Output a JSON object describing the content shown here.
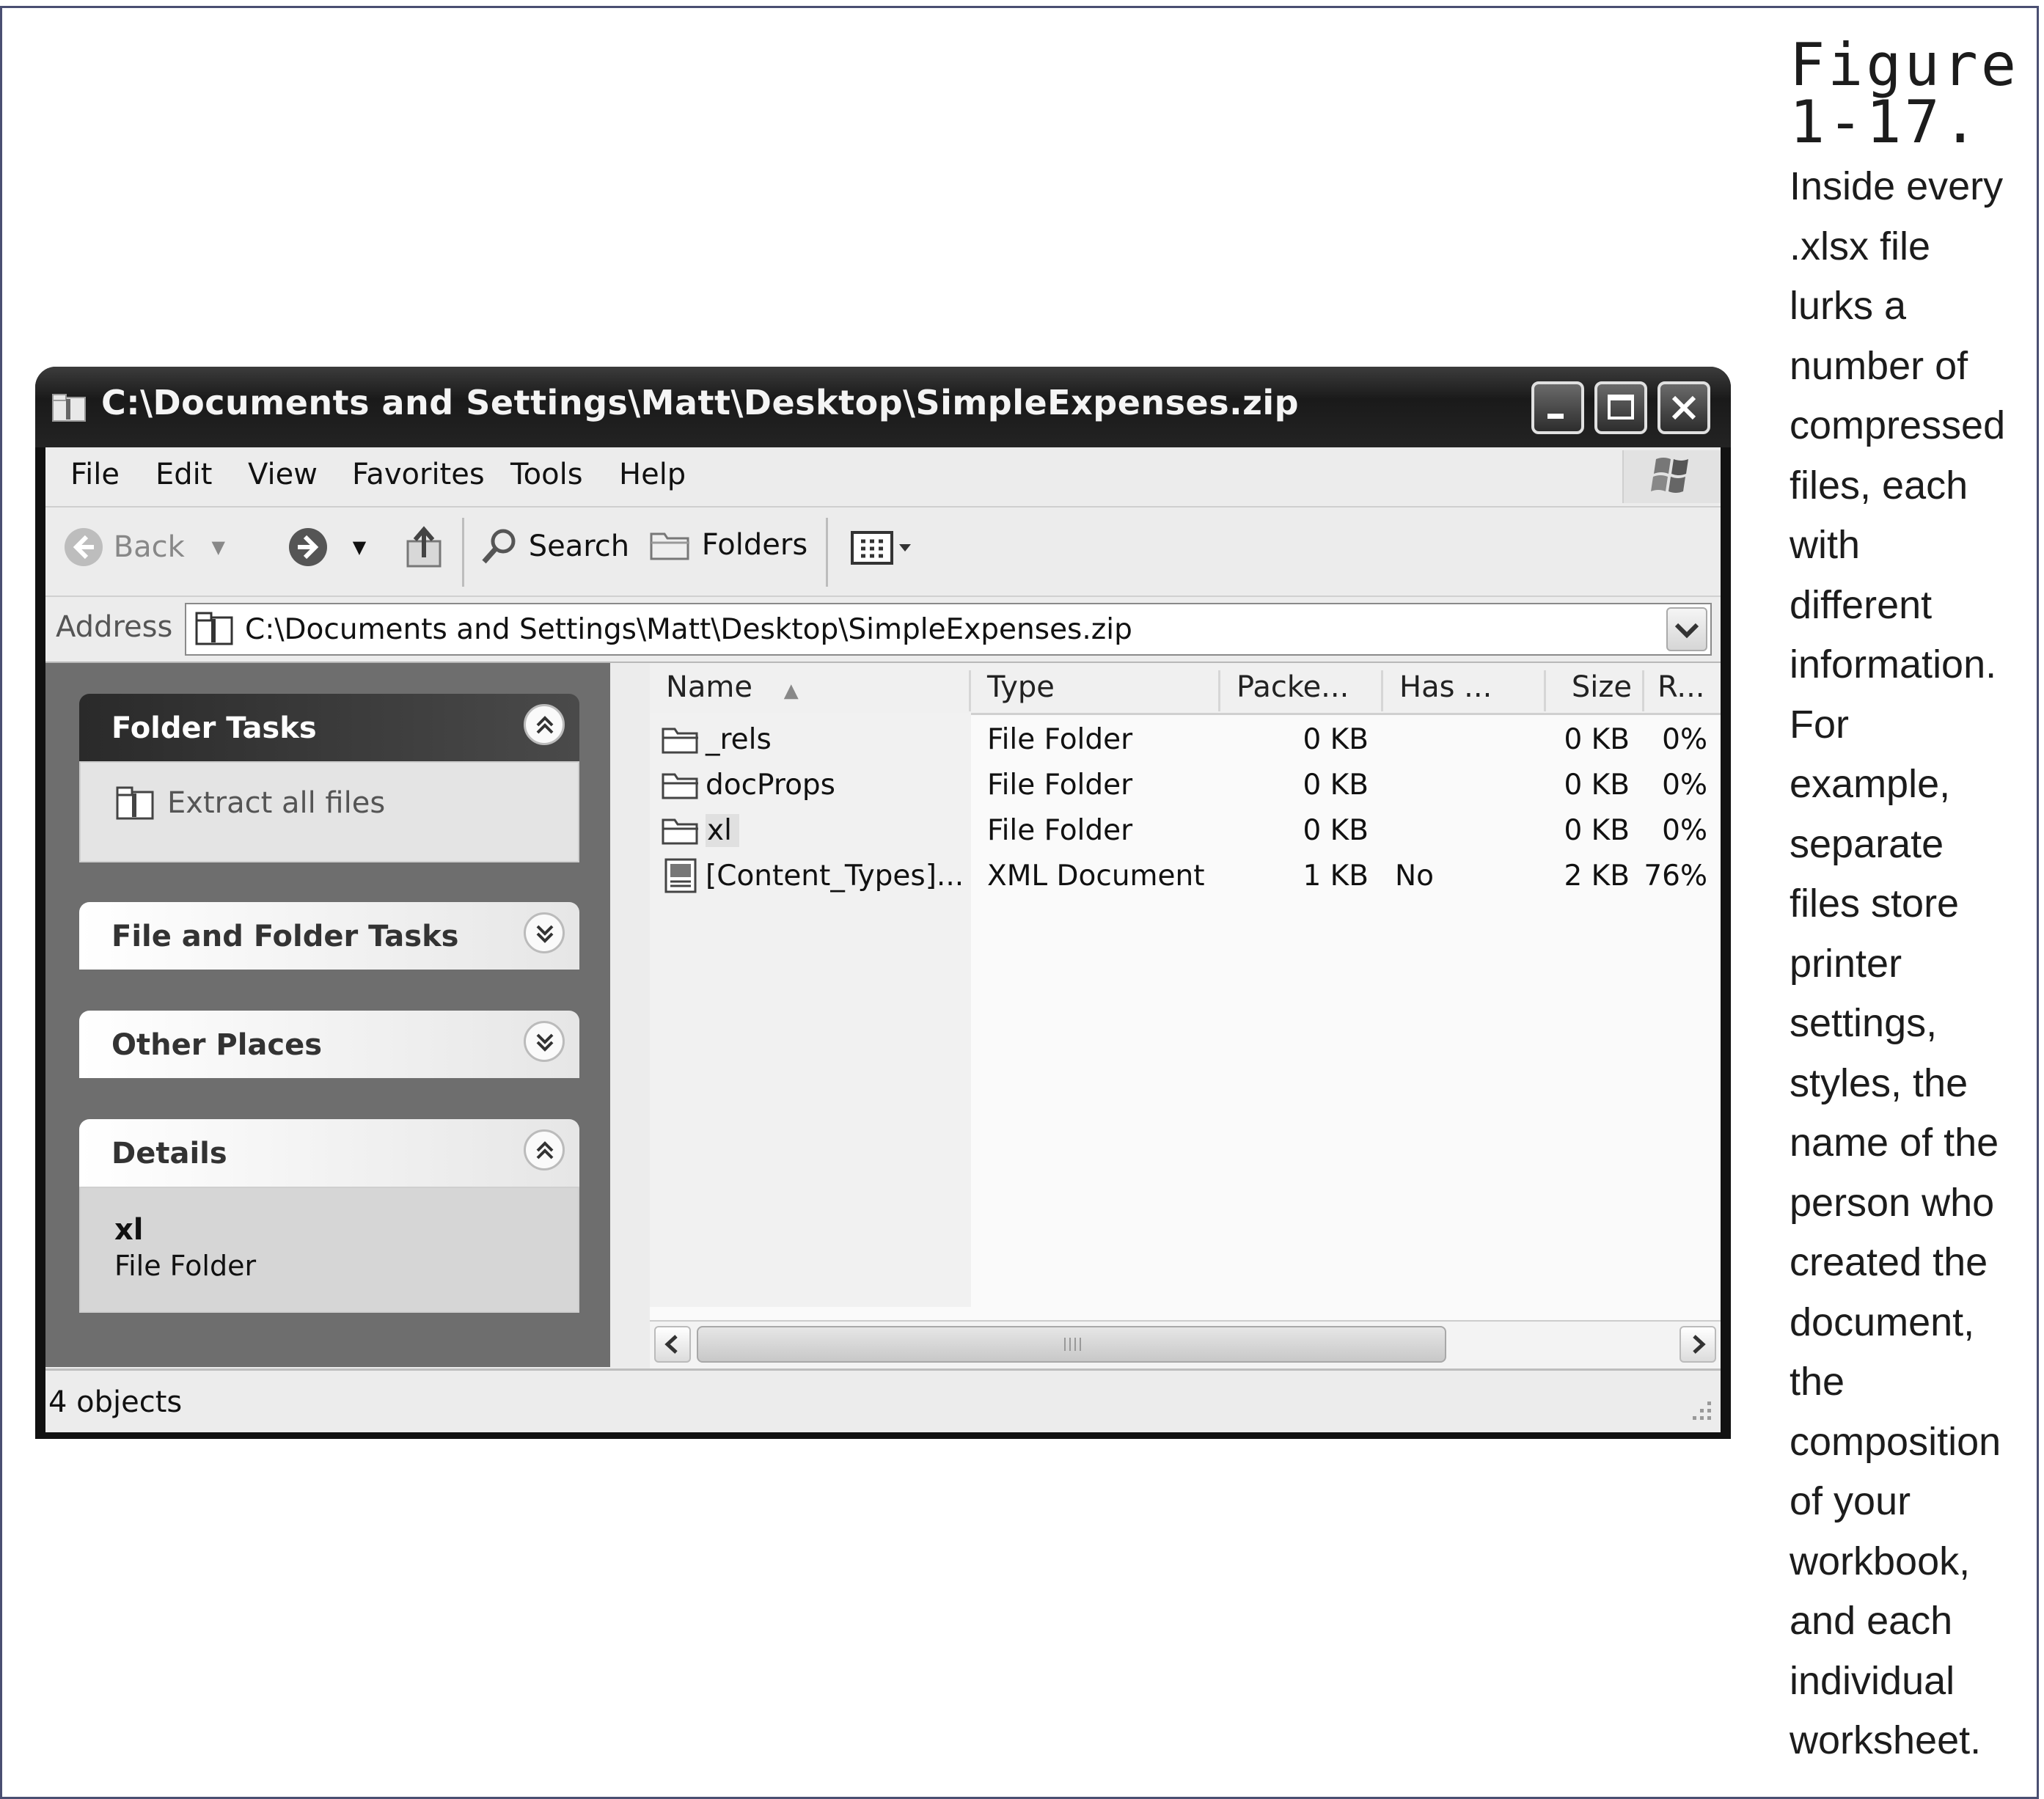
{
  "caption": {
    "title_line1": "Figure",
    "title_line2": "1-17.",
    "lines": [
      "Inside every",
      ".xlsx file",
      "lurks a",
      "number of",
      "compressed",
      "files, each",
      "with",
      "different",
      "information.",
      "For",
      "example,",
      "separate",
      "files store",
      "printer",
      "settings,",
      "styles, the",
      "name of the",
      "person who",
      "created the",
      "document,",
      "the",
      "composition",
      "of your",
      "workbook,",
      "and each",
      "individual",
      "worksheet."
    ]
  },
  "window": {
    "title": "C:\\Documents and Settings\\Matt\\Desktop\\SimpleExpenses.zip",
    "controls": [
      "minimize-icon",
      "maximize-icon",
      "close-icon"
    ]
  },
  "menu": {
    "items": [
      "File",
      "Edit",
      "View",
      "Favorites",
      "Tools",
      "Help"
    ]
  },
  "toolbar": {
    "back": "Back",
    "search": "Search",
    "folders": "Folders"
  },
  "address": {
    "label": "Address",
    "value": "C:\\Documents and Settings\\Matt\\Desktop\\SimpleExpenses.zip"
  },
  "sidebar": {
    "folder_tasks": {
      "title": "Folder Tasks",
      "item": "Extract all files"
    },
    "file_folder_tasks": {
      "title": "File and Folder Tasks"
    },
    "other_places": {
      "title": "Other Places"
    },
    "details": {
      "title": "Details",
      "name": "xl",
      "type": "File Folder"
    }
  },
  "filelist": {
    "columns": [
      "Name",
      "Type",
      "Packe...",
      "Has ...",
      "Size",
      "R..."
    ],
    "rows": [
      {
        "name": "_rels",
        "type": "File Folder",
        "packed": "0 KB",
        "has": "",
        "size": "0 KB",
        "ratio": "0%",
        "icon": "folder-icon"
      },
      {
        "name": "docProps",
        "type": "File Folder",
        "packed": "0 KB",
        "has": "",
        "size": "0 KB",
        "ratio": "0%",
        "icon": "folder-icon"
      },
      {
        "name": "xl",
        "type": "File Folder",
        "packed": "0 KB",
        "has": "",
        "size": "0 KB",
        "ratio": "0%",
        "icon": "folder-icon"
      },
      {
        "name": "[Content_Types]...",
        "type": "XML Document",
        "packed": "1 KB",
        "has": "No",
        "size": "2 KB",
        "ratio": "76%",
        "icon": "xml-document-icon"
      }
    ]
  },
  "status": {
    "text": "4 objects"
  }
}
